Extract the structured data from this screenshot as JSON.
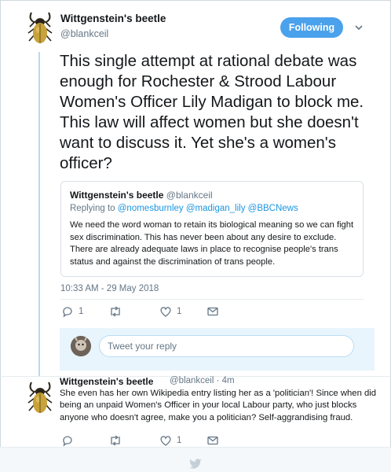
{
  "main_tweet": {
    "author_name": "Wittgenstein's beetle",
    "author_handle": "@blankceil",
    "follow_label": "Following",
    "text": "This single attempt at rational debate was enough for Rochester & Strood Labour Women's Officer Lily Madigan to block me. This law will affect women but she doesn't want to discuss it. Yet she's a women's officer?",
    "timestamp": "10:33 AM - 29 May 2018",
    "reply_count": "1",
    "like_count": "1"
  },
  "quoted_tweet": {
    "author_name": "Wittgenstein's beetle",
    "author_handle": "@blankceil",
    "replying_prefix": "Replying to",
    "replying_to": "@nomesburnley @madigan_lily @BBCNews",
    "text": "We need the word woman to retain its biological meaning so we can fight sex discrimination. This has never been about any desire to exclude. There are already adequate laws in place to recognise people's trans status and against the discrimination of trans people."
  },
  "reply_composer": {
    "placeholder": "Tweet your reply"
  },
  "reply_tweet": {
    "author_name": "Wittgenstein's beetle",
    "meta": "@blankceil · 4m",
    "text": "She even has her own Wikipedia entry listing her as a 'politician'! Since when did being an unpaid Women's Officer in your local Labour party, who just blocks anyone who doesn't agree, make you a politician? Self-aggrandising fraud.",
    "like_count": "1"
  },
  "colors": {
    "accent": "#4aa1ec",
    "thread_line": "#b8dbf5",
    "reply_box_bg": "#e8f5fd",
    "muted_text": "#657786",
    "link": "#1b95e0"
  },
  "icons": [
    "beetle-avatar",
    "chevron-down-icon",
    "reply-icon",
    "retweet-icon",
    "like-icon",
    "message-icon",
    "twitter-bird-icon"
  ]
}
